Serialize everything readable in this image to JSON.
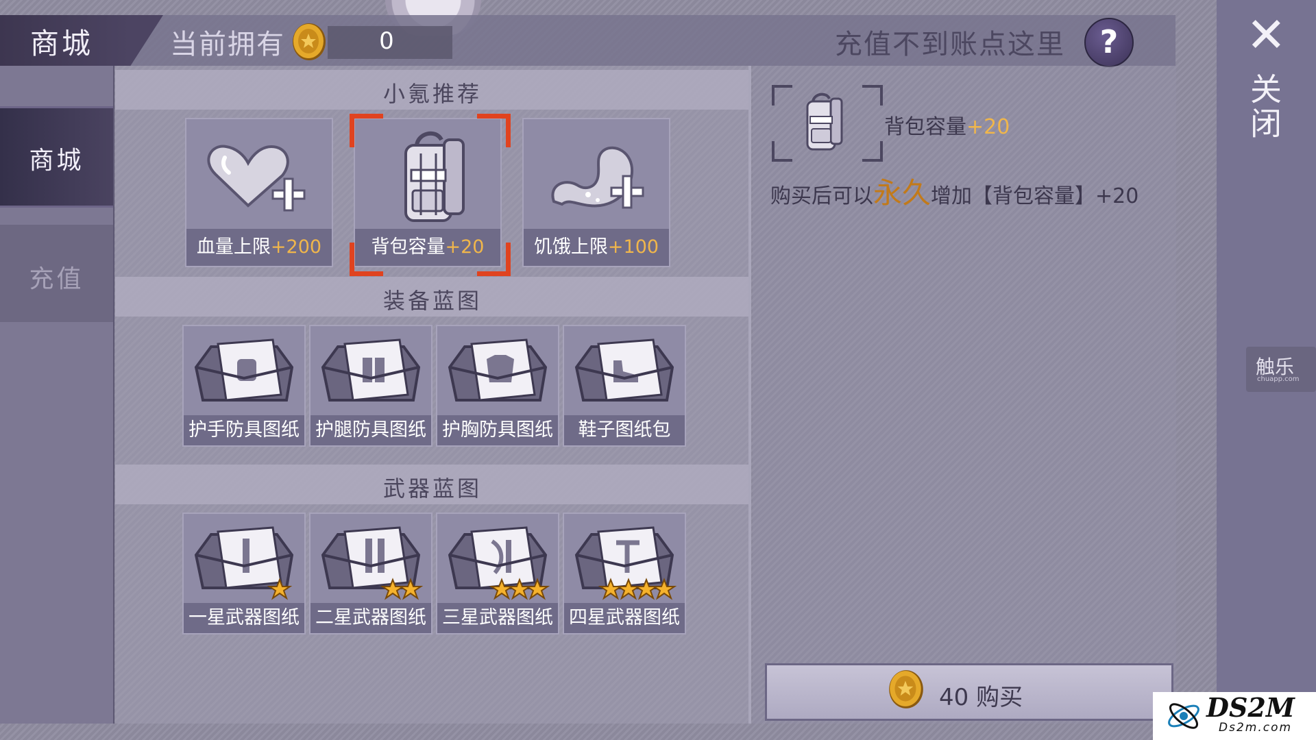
{
  "header": {
    "title": "商城",
    "owned_label": "当前拥有",
    "owned_value": "0",
    "recharge_help": "充值不到账点这里",
    "help_symbol": "?"
  },
  "nav": {
    "shop": "商城",
    "recharge": "充值"
  },
  "sections": {
    "recommended": "小氪推荐",
    "equipment": "装备蓝图",
    "weapon": "武器蓝图"
  },
  "recommended_items": [
    {
      "name": "血量上限",
      "bonus": "+200",
      "icon": "heart-plus-icon"
    },
    {
      "name": "背包容量",
      "bonus": "+20",
      "icon": "backpack-icon"
    },
    {
      "name": "饥饿上限",
      "bonus": "+100",
      "icon": "stomach-plus-icon"
    }
  ],
  "equipment_items": [
    {
      "name": "护手防具图纸",
      "icon": "blueprint-toolbox-icon"
    },
    {
      "name": "护腿防具图纸",
      "icon": "blueprint-toolbox-icon"
    },
    {
      "name": "护胸防具图纸",
      "icon": "blueprint-toolbox-icon"
    },
    {
      "name": "鞋子图纸包",
      "icon": "blueprint-toolbox-icon"
    }
  ],
  "weapon_items": [
    {
      "name": "一星武器图纸",
      "stars": 1,
      "icon": "blueprint-toolbox-icon"
    },
    {
      "name": "二星武器图纸",
      "stars": 2,
      "icon": "blueprint-toolbox-icon"
    },
    {
      "name": "三星武器图纸",
      "stars": 3,
      "icon": "blueprint-toolbox-icon"
    },
    {
      "name": "四星武器图纸",
      "stars": 4,
      "icon": "blueprint-toolbox-icon"
    }
  ],
  "selected_index": 1,
  "detail": {
    "name": "背包容量",
    "bonus": "+20",
    "desc_prefix": "购买后可以",
    "desc_emphasis": "永久",
    "desc_suffix": "增加【背包容量】+20"
  },
  "buy": {
    "label": "40 购买"
  },
  "close": {
    "icon": "✕",
    "label": "关闭"
  },
  "watermarks": {
    "chule_main": "触乐",
    "chule_sub": "chuapp.com",
    "ds2m_main": "DS2M",
    "ds2m_sub": "Ds2m.com"
  },
  "colors": {
    "accent_gold": "#f0b64b",
    "selection": "#e0431f",
    "emphasis": "#c27a1a"
  }
}
